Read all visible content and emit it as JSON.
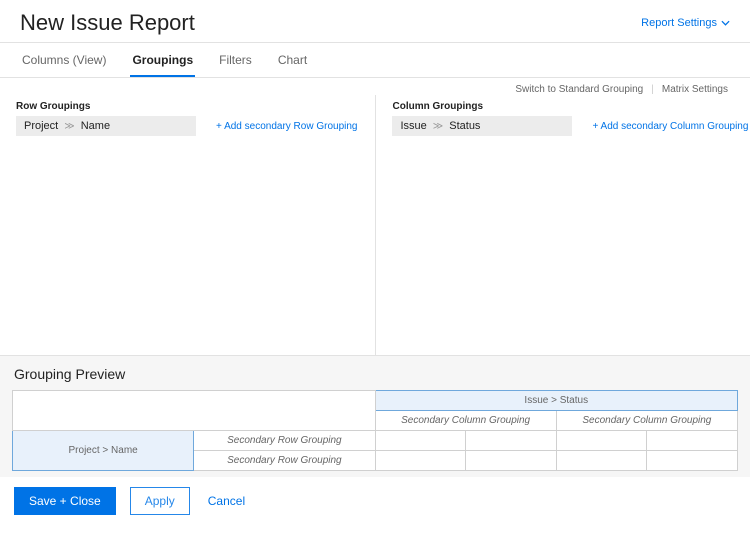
{
  "header": {
    "title": "New Issue Report",
    "report_settings_label": "Report Settings"
  },
  "tabs": {
    "items": [
      {
        "label": "Columns (View)"
      },
      {
        "label": "Groupings"
      },
      {
        "label": "Filters"
      },
      {
        "label": "Chart"
      }
    ],
    "active_index": 1
  },
  "config_links": {
    "switch": "Switch to Standard Grouping",
    "matrix": "Matrix Settings"
  },
  "row_groupings": {
    "title": "Row Groupings",
    "primary": {
      "object": "Project",
      "field": "Name"
    },
    "add_secondary_label": "+ Add secondary Row Grouping"
  },
  "column_groupings": {
    "title": "Column Groupings",
    "primary": {
      "object": "Issue",
      "field": "Status"
    },
    "add_secondary_label": "+ Add secondary Column Grouping"
  },
  "preview": {
    "title": "Grouping Preview",
    "col_header": "Issue > Status",
    "row_header": "Project > Name",
    "secondary_col_label": "Secondary Column Grouping",
    "secondary_row_label": "Secondary Row Grouping"
  },
  "footer": {
    "save": "Save + Close",
    "apply": "Apply",
    "cancel": "Cancel"
  }
}
